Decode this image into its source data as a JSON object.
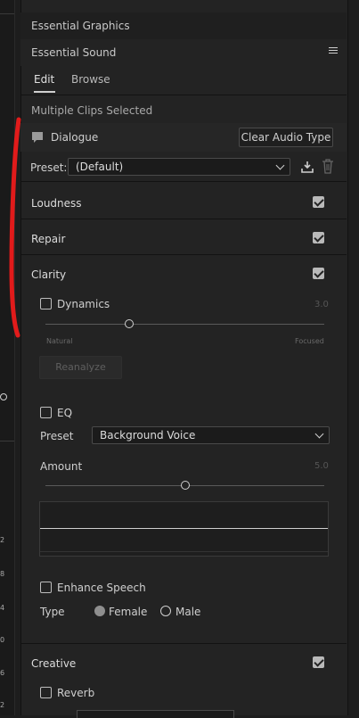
{
  "panels": {
    "graphics_title": "Essential Graphics",
    "sound_title": "Essential Sound"
  },
  "tabs": [
    {
      "label": "Edit",
      "active": true
    },
    {
      "label": "Browse",
      "active": false
    }
  ],
  "status": "Multiple Clips Selected",
  "audio_type": {
    "label": "Dialogue",
    "clear_button": "Clear Audio Type"
  },
  "preset": {
    "label": "Preset:",
    "value": "(Default)"
  },
  "sections": {
    "loudness": {
      "label": "Loudness",
      "checked": true
    },
    "repair": {
      "label": "Repair",
      "checked": true
    },
    "clarity": {
      "label": "Clarity",
      "checked": true
    },
    "creative": {
      "label": "Creative",
      "checked": true
    }
  },
  "dynamics": {
    "label": "Dynamics",
    "checked": false,
    "value": "3.0",
    "level_fraction": 0.3,
    "min_label": "Natural",
    "max_label": "Focused",
    "reanalyze": "Reanalyze"
  },
  "eq": {
    "label": "EQ",
    "checked": false,
    "preset_label": "Preset",
    "preset_value": "Background Voice",
    "amount_label": "Amount",
    "amount_value": "5.0",
    "amount_fraction": 0.5
  },
  "enhance_speech": {
    "label": "Enhance Speech",
    "checked": false,
    "type_label": "Type",
    "options": [
      "Female",
      "Male"
    ],
    "selected": "Female"
  },
  "reverb": {
    "label": "Reverb",
    "checked": false
  },
  "ruler_ticks": [
    "2",
    "8",
    "4",
    "0",
    "6",
    "2"
  ],
  "colors": {
    "accent_annotation": "#e11b1b"
  }
}
